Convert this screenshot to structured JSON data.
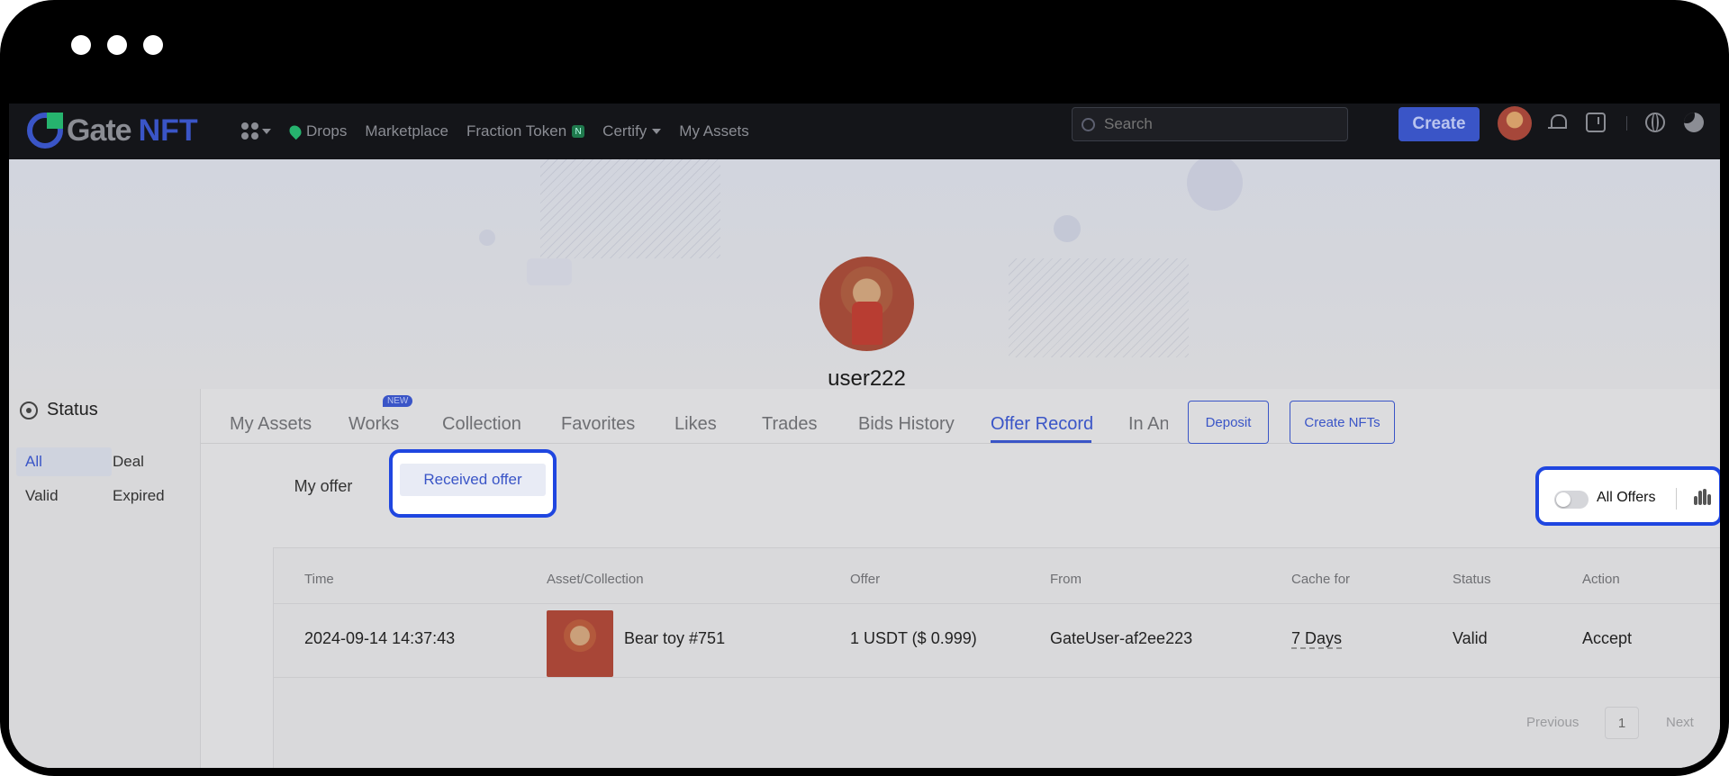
{
  "window": {
    "controls": [
      "close",
      "minimize",
      "maximize"
    ]
  },
  "nav": {
    "logo_gate": "Gate",
    "logo_nft": "NFT",
    "links": [
      "Drops",
      "Marketplace",
      "Fraction Token",
      "Certify",
      "My Assets"
    ],
    "fraction_badge": "N",
    "search_placeholder": "Search",
    "create_label": "Create",
    "icons": [
      "apps-icon",
      "bell-icon",
      "download-icon",
      "globe-icon",
      "moon-icon"
    ]
  },
  "profile": {
    "username": "user222"
  },
  "sidebar": {
    "title": "Status",
    "filters": [
      "All",
      "Deal",
      "Valid",
      "Expired"
    ],
    "active_filter": "All"
  },
  "tabs": {
    "items": [
      "My Assets",
      "Works",
      "Collection",
      "Favorites",
      "Likes",
      "Trades",
      "Bids History",
      "Offer Record",
      "In Anc"
    ],
    "active": "Offer Record",
    "works_badge": "NEW",
    "deposit_label": "Deposit",
    "create_nfts_label": "Create NFTs"
  },
  "subtabs": {
    "my_offer": "My offer",
    "received_offer": "Received offer",
    "active": "Received offer"
  },
  "all_offers": {
    "label": "All Offers",
    "enabled": false
  },
  "table": {
    "headers": [
      "Time",
      "Asset/Collection",
      "Offer",
      "From",
      "Cache for",
      "Status",
      "Action"
    ],
    "rows": [
      {
        "time": "2024-09-14 14:37:43",
        "asset": "Bear toy #751",
        "offer": "1 USDT ($ 0.999)",
        "from": "GateUser-af2ee223",
        "cache_for": "7 Days",
        "status": "Valid",
        "action": "Accept"
      }
    ]
  },
  "pagination": {
    "previous": "Previous",
    "page": "1",
    "next": "Next"
  },
  "colors": {
    "accent": "#3a55c7",
    "highlight_border": "#1f46e0",
    "nav_bg": "#141519"
  }
}
